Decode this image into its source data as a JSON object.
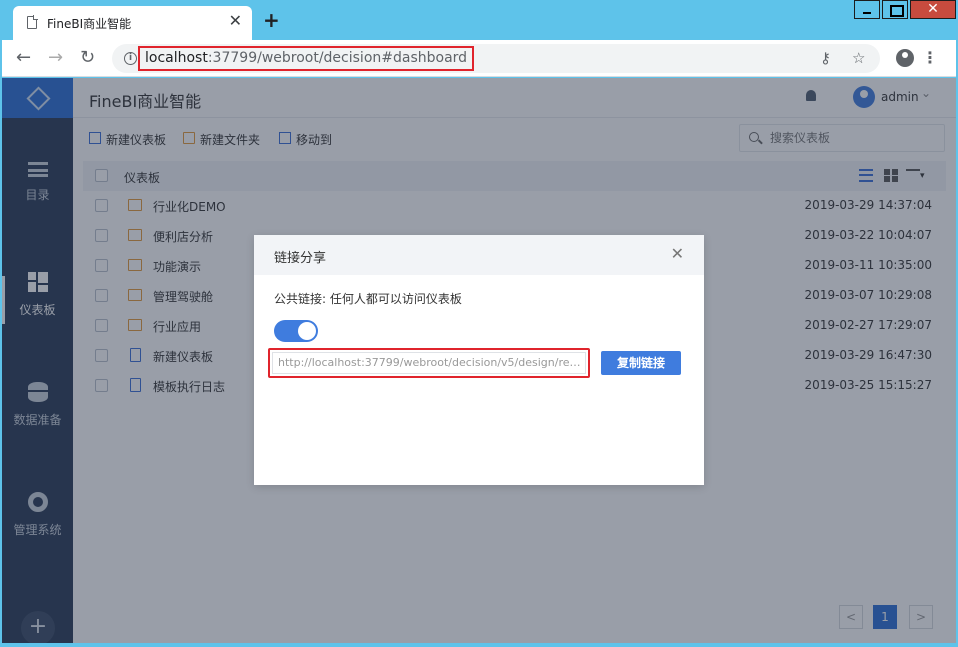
{
  "browser": {
    "tab_title": "FineBI商业智能",
    "new_tab": "+",
    "url_host": "localhost",
    "url_path": ":37799/webroot/decision#dashboard",
    "window_buttons": [
      "minimize",
      "maximize",
      "close"
    ]
  },
  "app": {
    "title": "FineBI商业智能",
    "user": "admin"
  },
  "sidebar": {
    "items": [
      {
        "label": "目录",
        "icon": "catalog-icon"
      },
      {
        "label": "仪表板",
        "icon": "dashboard-icon",
        "active": true
      },
      {
        "label": "数据准备",
        "icon": "database-icon"
      },
      {
        "label": "管理系统",
        "icon": "gear-icon"
      }
    ],
    "add_label": "+"
  },
  "toolbar": {
    "new_dashboard": "新建仪表板",
    "new_folder": "新建文件夹",
    "move_to": "移动到",
    "search_placeholder": "搜索仪表板"
  },
  "list": {
    "header": "仪表板",
    "rows": [
      {
        "name": "行业化DEMO",
        "type": "folder",
        "time": "2019-03-29 14:37:04"
      },
      {
        "name": "便利店分析",
        "type": "folder",
        "time": "2019-03-22 10:04:07"
      },
      {
        "name": "功能演示",
        "type": "folder",
        "time": "2019-03-11 10:35:00"
      },
      {
        "name": "管理驾驶舱",
        "type": "folder",
        "time": "2019-03-07 10:29:08"
      },
      {
        "name": "行业应用",
        "type": "folder",
        "time": "2019-02-27 17:29:07"
      },
      {
        "name": "新建仪表板",
        "type": "dashboard",
        "time": "2019-03-29 16:47:30"
      },
      {
        "name": "模板执行日志",
        "type": "dashboard",
        "time": "2019-03-25 15:15:27"
      }
    ]
  },
  "pagination": {
    "prev": "<",
    "current": "1",
    "next": ">"
  },
  "dialog": {
    "title": "链接分享",
    "description": "公共链接: 任何人都可以访问仪表板",
    "toggle_on": true,
    "link": "http://localhost:37799/webroot/decision/v5/design/repo...",
    "copy_button": "复制链接",
    "close": "✕"
  },
  "colors": {
    "accent": "#3f7cde",
    "sidebar": "#293a55",
    "highlight_border": "#e0242c",
    "folder": "#e39a3a"
  }
}
